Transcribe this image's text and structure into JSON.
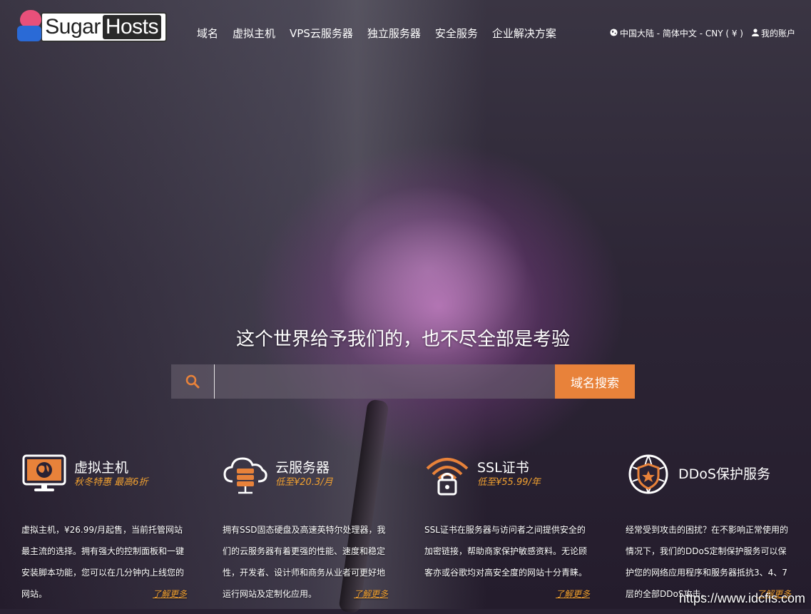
{
  "logo": {
    "text_a": "Sugar",
    "text_b": "Hosts"
  },
  "nav": [
    "域名",
    "虚拟主机",
    "VPS云服务器",
    "独立服务器",
    "安全服务",
    "企业解决方案"
  ],
  "top_right": {
    "locale": "中国大陆 - 简体中文 - CNY ( ¥ )",
    "account": "我的账户"
  },
  "hero": {
    "title": "这个世界给予我们的，也不尽全部是考验"
  },
  "search": {
    "value": "",
    "button": "域名搜索"
  },
  "features": [
    {
      "title": "虚拟主机",
      "subtitle": "秋冬特惠 最高6折",
      "desc": "虚拟主机，¥26.99/月起售，当前托管网站最主流的选择。拥有强大的控制面板和一键安装脚本功能，您可以在几分钟内上线您的网站。",
      "more": "了解更多"
    },
    {
      "title": "云服务器",
      "subtitle": "低至¥20.3/月",
      "desc": "拥有SSD固态硬盘及高速英特尔处理器，我们的云服务器有着更强的性能、速度和稳定性，开发者、设计师和商务从业者可更好地运行网站及定制化应用。",
      "more": "了解更多"
    },
    {
      "title": "SSL证书",
      "subtitle": "低至¥55.99/年",
      "desc": "SSL证书在服务器与访问者之间提供安全的加密链接，帮助商家保护敏感资料。无论顾客亦或谷歌均对高安全度的网站十分青睐。",
      "more": "了解更多"
    },
    {
      "title": "DDoS保护服务",
      "subtitle": "",
      "desc": "经常受到攻击的困扰？在不影响正常使用的情况下，我们的DDoS定制保护服务可以保护您的网络应用程序和服务器抵抗3、4、7层的全部DDoS攻击。",
      "more": "了解更多"
    }
  ],
  "watermark": "https://www.idcfis.com",
  "colors": {
    "accent": "#e8823a",
    "highlight": "#f0a030"
  },
  "icons": [
    "globe-icon",
    "user-icon",
    "search-icon",
    "monitor-globe-icon",
    "cloud-server-icon",
    "wifi-lock-icon",
    "shield-network-icon"
  ]
}
